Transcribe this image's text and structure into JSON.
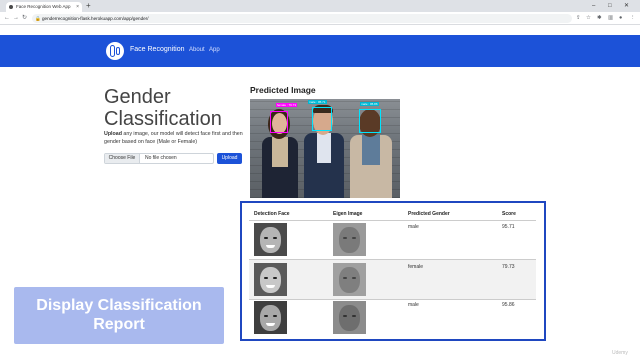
{
  "browser": {
    "tab_title": "Face Recognition Web App",
    "tab_close": "×",
    "new_tab": "+",
    "url": "genderrecognition-flask.herokuapp.com/app/gender/",
    "win_min": "–",
    "win_max": "□",
    "win_close": "✕"
  },
  "navbar": {
    "brand": "Face Recognition",
    "links": [
      "About",
      "App"
    ]
  },
  "page": {
    "title": "Gender Classification",
    "description_bold": "Upload",
    "description_rest": " any image, our model will detect face first and then gender based on face (Male or Female)",
    "choose_file": "Choose File",
    "no_file": "No file chosen",
    "upload_button": "Upload"
  },
  "prediction": {
    "title": "Predicted Image",
    "box_labels": [
      "female : 79.73",
      "male : 95.71",
      "male : 95.86"
    ],
    "box_colors": [
      "#ff00ff",
      "#00e5ff",
      "#00e5ff"
    ]
  },
  "table": {
    "headers": [
      "Detection Face",
      "Eigen Image",
      "Predicted Gender",
      "Score"
    ],
    "rows": [
      {
        "gender": "male",
        "score": "95.71"
      },
      {
        "gender": "female",
        "score": "79.73"
      },
      {
        "gender": "male",
        "score": "95.86"
      }
    ]
  },
  "caption": {
    "line1": "Display Classification",
    "line2": "Report"
  },
  "watermark": "Udemy",
  "colors": {
    "navbar": "#1c52d8",
    "panel_border": "#1f47c0",
    "caption_bg": "#a9b9ee"
  }
}
